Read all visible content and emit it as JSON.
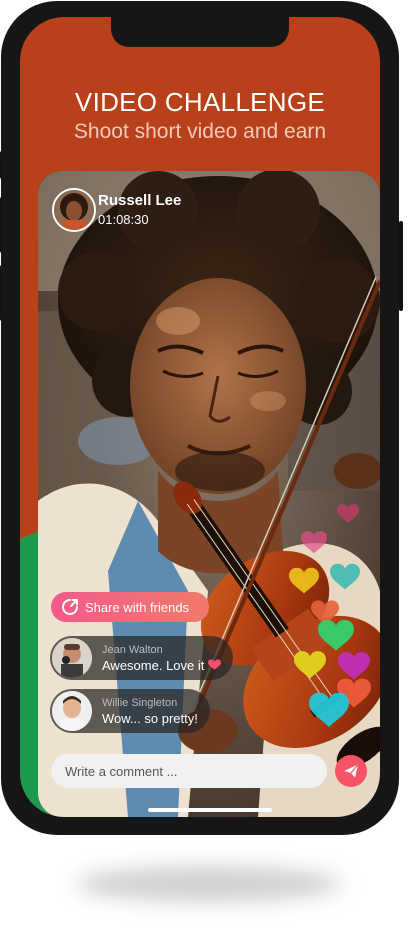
{
  "header": {
    "title": "VIDEO CHALLENGE",
    "subtitle": "Shoot short video and earn"
  },
  "stream": {
    "user_name": "Russell Lee",
    "elapsed_time": "01:08:30"
  },
  "share_button": {
    "label": "Share with friends",
    "icon": "share-icon"
  },
  "comments": [
    {
      "user": "Jean Walton",
      "text": "Awesome. Love it",
      "icon": "heart-icon"
    },
    {
      "user": "Willie Singleton",
      "text": "Wow... so pretty!"
    }
  ],
  "comment_input": {
    "placeholder": "Write a comment ..."
  },
  "send_button": {
    "icon": "send-icon"
  },
  "floating_reactions": {
    "icon": "heart-icon",
    "colors": [
      "#c93a6a",
      "#e64d86",
      "#f0c419",
      "#35b8b0",
      "#e8623a",
      "#34d06e",
      "#e2d41c",
      "#c22fc3",
      "#ee5b3a",
      "#22c6d6"
    ]
  },
  "colors": {
    "brand_orange": "#b8411b",
    "accent_green": "#1c9a50",
    "share_gradient_start": "#f25a8a",
    "share_gradient_end": "#f07a6a",
    "send_red": "#f55468"
  }
}
